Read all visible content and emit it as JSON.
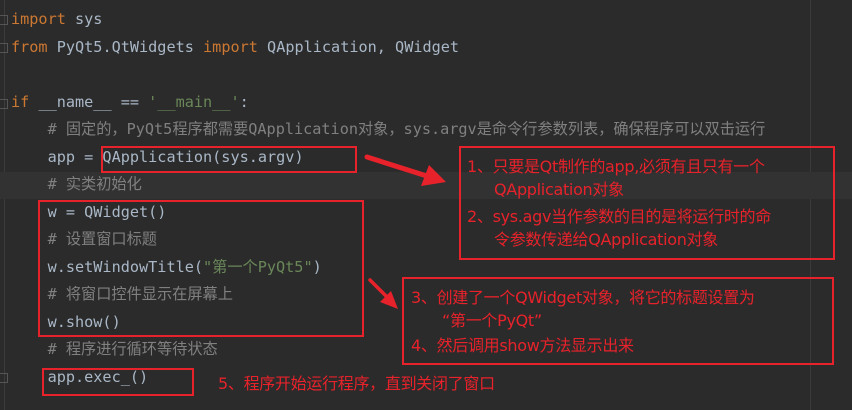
{
  "code": {
    "lines": [
      {
        "parts": [
          {
            "t": "import",
            "c": "kw"
          },
          {
            "t": " sys",
            "c": ""
          }
        ]
      },
      {
        "parts": [
          {
            "t": "from",
            "c": "kw"
          },
          {
            "t": " PyQt5.QtWidgets ",
            "c": ""
          },
          {
            "t": "import",
            "c": "kw"
          },
          {
            "t": " QApplication, QWidget",
            "c": ""
          }
        ]
      },
      {
        "parts": []
      },
      {
        "parts": [
          {
            "t": "if",
            "c": "kw"
          },
          {
            "t": " __name__ == ",
            "c": ""
          },
          {
            "t": "'__main__'",
            "c": "str"
          },
          {
            "t": ":",
            "c": ""
          }
        ]
      },
      {
        "parts": [
          {
            "t": "    # 固定的，PyQt5程序都需要QApplication对象，sys.argv是命令行参数列表，确保程序可以双击运行",
            "c": "cm"
          }
        ]
      },
      {
        "parts": [
          {
            "t": "    app = QApplication(sys.argv)",
            "c": ""
          }
        ]
      },
      {
        "parts": [
          {
            "t": "    # 实类初始化",
            "c": "cm"
          }
        ]
      },
      {
        "parts": [
          {
            "t": "    w = QWidget()",
            "c": ""
          }
        ]
      },
      {
        "parts": [
          {
            "t": "    # 设置窗口标题",
            "c": "cm"
          }
        ]
      },
      {
        "parts": [
          {
            "t": "    w.setWindowTitle(",
            "c": ""
          },
          {
            "t": "\"第一个PyQt5\"",
            "c": "str"
          },
          {
            "t": ")",
            "c": ""
          }
        ]
      },
      {
        "parts": [
          {
            "t": "    # 将窗口控件显示在屏幕上",
            "c": "cm"
          }
        ]
      },
      {
        "parts": [
          {
            "t": "    w.show()",
            "c": ""
          }
        ]
      },
      {
        "parts": [
          {
            "t": "    # 程序进行循环等待状态",
            "c": "cm"
          }
        ]
      },
      {
        "parts": [
          {
            "t": "    app.exec_()",
            "c": ""
          }
        ]
      }
    ]
  },
  "annotations": {
    "note1_line1": "1、只要是Qt制作的app,必须有且只有一个",
    "note1_line2": "QApplication对象",
    "note2_line1": "2、sys.agv当作参数的目的是将运行时的命",
    "note2_line2": "令参数传递给QApplication对象",
    "note3_line1": "3、创建了一个QWidget对象，将它的标题设置为",
    "note3_line2": "“第一个PyQt”",
    "note4": "4、然后调用show方法显示出来",
    "note5": "5、程序开始运行程序，直到关闭了窗口"
  },
  "colors": {
    "accent": "#e8222b",
    "background": "#2b2b2b",
    "keyword": "#cc7832",
    "string": "#6a8759",
    "comment": "#808080",
    "text": "#a9b7c6"
  }
}
